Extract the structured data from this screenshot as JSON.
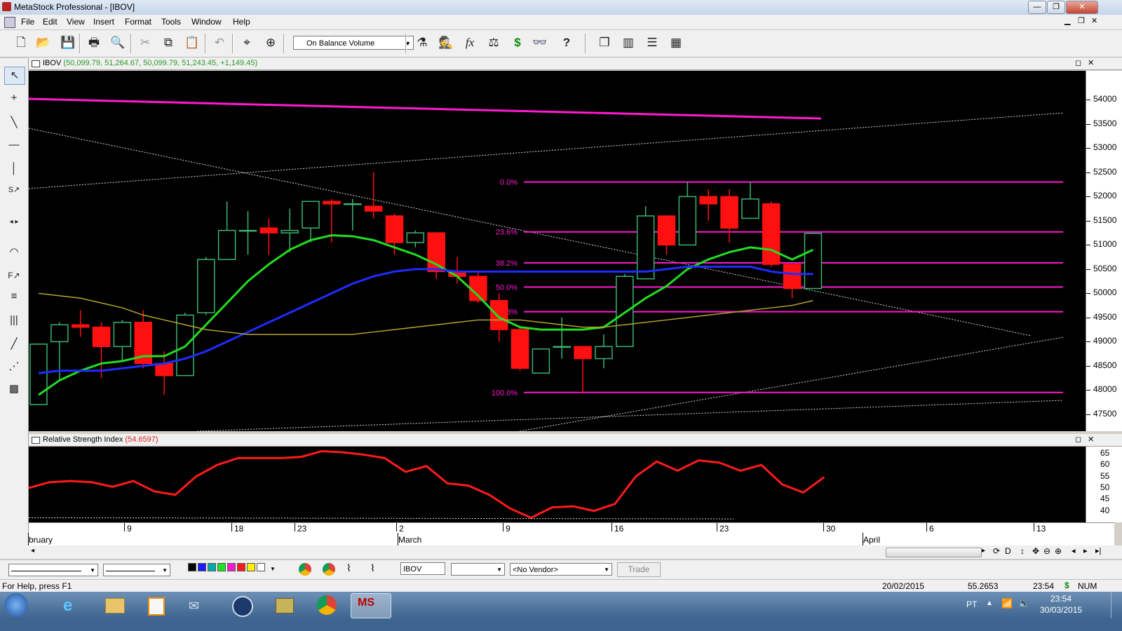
{
  "window": {
    "title": "MetaStock Professional - [IBOV]"
  },
  "menu": [
    "File",
    "Edit",
    "View",
    "Insert",
    "Format",
    "Tools",
    "Window",
    "Help"
  ],
  "toolbar": {
    "indicator_select": "On Balance Volume"
  },
  "price_pane": {
    "symbol": "IBOV",
    "ohlc_text": "(50,099.79, 51,264.67, 50,099.79, 51,243.45, +1,149.45)",
    "fib_labels": [
      "0.0%",
      "23.6%",
      "38.2%",
      "50.0%",
      "61.8%",
      "100.0%"
    ]
  },
  "rsi_pane": {
    "title": "Relative Strength Index",
    "value": "(54.6597)"
  },
  "chart_data": [
    {
      "type": "candlestick",
      "title": "IBOV",
      "ylim": [
        47150,
        54600
      ],
      "y_ticks": [
        "54000",
        "53500",
        "53000",
        "52500",
        "52000",
        "51500",
        "51000",
        "50500",
        "50000",
        "49500",
        "49000",
        "48500",
        "48000",
        "47500"
      ],
      "x_date_labels": [
        "9",
        "18",
        "23",
        "2",
        "9",
        "16",
        "23",
        "30",
        "6",
        "13"
      ],
      "x_month_labels": [
        "bruary",
        "March",
        "April"
      ],
      "candles": [
        {
          "o": 47700,
          "h": 48950,
          "l": 47700,
          "c": 48950
        },
        {
          "o": 49000,
          "h": 49400,
          "l": 48200,
          "c": 49350
        },
        {
          "o": 49350,
          "h": 49650,
          "l": 49100,
          "c": 49300
        },
        {
          "o": 49300,
          "h": 49400,
          "l": 48250,
          "c": 48900
        },
        {
          "o": 48900,
          "h": 49450,
          "l": 48600,
          "c": 49400
        },
        {
          "o": 49400,
          "h": 49650,
          "l": 48450,
          "c": 48550
        },
        {
          "o": 48550,
          "h": 48800,
          "l": 47900,
          "c": 48300
        },
        {
          "o": 48300,
          "h": 49600,
          "l": 48300,
          "c": 49550
        },
        {
          "o": 49600,
          "h": 50750,
          "l": 49550,
          "c": 50700
        },
        {
          "o": 50700,
          "h": 51900,
          "l": 50700,
          "c": 51300
        },
        {
          "o": 51300,
          "h": 51700,
          "l": 50800,
          "c": 51300
        },
        {
          "o": 51350,
          "h": 51550,
          "l": 50800,
          "c": 51250
        },
        {
          "o": 51250,
          "h": 51750,
          "l": 50850,
          "c": 51300
        },
        {
          "o": 51350,
          "h": 51900,
          "l": 51050,
          "c": 51900
        },
        {
          "o": 51900,
          "h": 51950,
          "l": 51050,
          "c": 51850
        },
        {
          "o": 51850,
          "h": 51950,
          "l": 51300,
          "c": 51850
        },
        {
          "o": 51800,
          "h": 52500,
          "l": 51550,
          "c": 51700
        },
        {
          "o": 51600,
          "h": 51650,
          "l": 50800,
          "c": 51050
        },
        {
          "o": 51050,
          "h": 51300,
          "l": 50950,
          "c": 51250
        },
        {
          "o": 51250,
          "h": 51250,
          "l": 50300,
          "c": 50450
        },
        {
          "o": 50450,
          "h": 50750,
          "l": 50200,
          "c": 50350
        },
        {
          "o": 50350,
          "h": 50450,
          "l": 49800,
          "c": 49850
        },
        {
          "o": 49850,
          "h": 50000,
          "l": 49000,
          "c": 49250
        },
        {
          "o": 49250,
          "h": 49300,
          "l": 48400,
          "c": 48450
        },
        {
          "o": 48350,
          "h": 48850,
          "l": 48350,
          "c": 48850
        },
        {
          "o": 48900,
          "h": 49500,
          "l": 48650,
          "c": 48900
        },
        {
          "o": 48900,
          "h": 48900,
          "l": 47950,
          "c": 48650
        },
        {
          "o": 48650,
          "h": 49150,
          "l": 48450,
          "c": 48900
        },
        {
          "o": 48900,
          "h": 50400,
          "l": 48900,
          "c": 50350
        },
        {
          "o": 50300,
          "h": 51800,
          "l": 50300,
          "c": 51600
        },
        {
          "o": 51600,
          "h": 51600,
          "l": 50800,
          "c": 51000
        },
        {
          "o": 51000,
          "h": 52300,
          "l": 51000,
          "c": 52000
        },
        {
          "o": 52000,
          "h": 52150,
          "l": 51500,
          "c": 51850
        },
        {
          "o": 52000,
          "h": 52150,
          "l": 51050,
          "c": 51350
        },
        {
          "o": 51550,
          "h": 52300,
          "l": 51550,
          "c": 51950
        },
        {
          "o": 51850,
          "h": 51900,
          "l": 50550,
          "c": 50600
        },
        {
          "o": 50600,
          "h": 50600,
          "l": 49900,
          "c": 50100
        },
        {
          "o": 50100,
          "h": 51260,
          "l": 50100,
          "c": 51240
        }
      ],
      "moving_averages": [
        {
          "name": "green",
          "color": "#22dd22",
          "values": [
            47900,
            48200,
            48400,
            48550,
            48600,
            48700,
            48700,
            48900,
            49350,
            49800,
            50250,
            50600,
            50900,
            51100,
            51200,
            51180,
            51100,
            50950,
            50800,
            50600,
            50350,
            49950,
            49500,
            49300,
            49250,
            49250,
            49250,
            49300,
            49600,
            49900,
            50150,
            50500,
            50700,
            50850,
            50950,
            50900,
            50700,
            50900
          ]
        },
        {
          "name": "blue",
          "color": "#1f2cff",
          "values": [
            48350,
            48400,
            48400,
            48400,
            48450,
            48500,
            48550,
            48650,
            48800,
            49000,
            49200,
            49400,
            49600,
            49800,
            50000,
            50200,
            50350,
            50450,
            50500,
            50500,
            50450,
            50450,
            50450,
            50450,
            50450,
            50450,
            50450,
            50450,
            50450,
            50450,
            50500,
            50550,
            50550,
            50550,
            50550,
            50450,
            50400,
            50400
          ]
        },
        {
          "name": "olive",
          "color": "#b5a52a",
          "values": [
            50000,
            49950,
            49900,
            49800,
            49700,
            49550,
            49450,
            49350,
            49250,
            49200,
            49150,
            49150,
            49150,
            49150,
            49150,
            49150,
            49200,
            49250,
            49300,
            49350,
            49400,
            49450,
            49450,
            49450,
            49400,
            49350,
            49300,
            49300,
            49350,
            49400,
            49450,
            49500,
            49550,
            49600,
            49650,
            49700,
            49750,
            49850
          ]
        }
      ],
      "fibonacci": {
        "high": 52300,
        "low": 47950,
        "levels": [
          52300,
          51270,
          50630,
          50130,
          49620,
          47950
        ]
      }
    },
    {
      "type": "line",
      "title": "Relative Strength Index",
      "ylim": [
        35,
        68
      ],
      "y_ticks": [
        "65",
        "60",
        "55",
        "50",
        "45",
        "40"
      ],
      "series": [
        {
          "name": "Relative Strength Index",
          "color": "#ff1a1a",
          "values": [
            50,
            52.5,
            53,
            52.5,
            50.5,
            53,
            48.5,
            47,
            55,
            60,
            63,
            63,
            63,
            63.5,
            66,
            65.5,
            64.5,
            63,
            57,
            59.5,
            52,
            51,
            47,
            41,
            37,
            41.5,
            42,
            40,
            43,
            55,
            61.5,
            57.5,
            62,
            61,
            57.5,
            60,
            51.5,
            48,
            54.7
          ]
        }
      ]
    }
  ],
  "bottom": {
    "symbol_box": "IBOV",
    "vendor": "<No Vendor>",
    "trade": "Trade",
    "scroll_labels": "D"
  },
  "status": {
    "help": "For Help, press F1",
    "date": "20/02/2015",
    "value": "55.2653",
    "time": "23:54",
    "num": "NUM"
  },
  "taskbar": {
    "lang": "PT",
    "clock_time": "23:54",
    "clock_date": "30/03/2015"
  }
}
